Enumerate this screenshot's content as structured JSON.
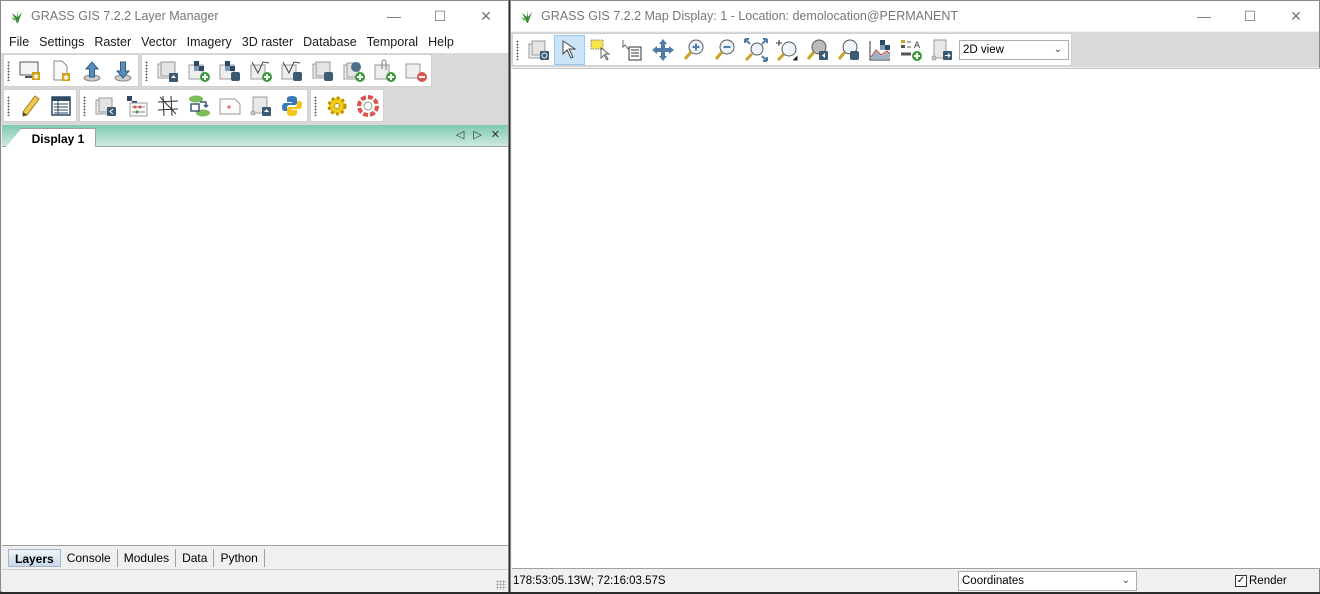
{
  "layer_manager": {
    "title": "GRASS GIS 7.2.2 Layer Manager",
    "window_controls": {
      "minimize": "—",
      "maximize": "☐",
      "close": "✕"
    },
    "menu": [
      "File",
      "Settings",
      "Raster",
      "Vector",
      "Imagery",
      "3D raster",
      "Database",
      "Temporal",
      "Help"
    ],
    "toolbar_row1": {
      "group1": [
        "new-display",
        "new-workspace",
        "load-workspace",
        "save-workspace"
      ],
      "group2": [
        "import-raster",
        "add-raster",
        "add-raster-misc",
        "add-vector",
        "add-vector-misc",
        "add-overlay",
        "add-web-service",
        "add-group",
        "remove-layer"
      ]
    },
    "toolbar_row2": {
      "group1": [
        "edit-vector",
        "attribute-table"
      ],
      "group2": [
        "georectify",
        "raster-calculator",
        "cartographic-composer",
        "graphical-modeler",
        "psmap",
        "script-launcher",
        "python-shell"
      ],
      "group3": [
        "settings",
        "help"
      ]
    },
    "notebook": {
      "tab": "Display 1",
      "controls": {
        "prev": "◁",
        "next": "▷",
        "close": "✕"
      }
    },
    "bottom_tabs": [
      {
        "label": "Layers",
        "selected": true
      },
      {
        "label": "Console",
        "selected": false
      },
      {
        "label": "Modules",
        "selected": false
      },
      {
        "label": "Data",
        "selected": false
      },
      {
        "label": "Python",
        "selected": false
      }
    ]
  },
  "map_display": {
    "title": "GRASS GIS 7.2.2 Map Display: 1 - Location: demolocation@PERMANENT",
    "window_controls": {
      "minimize": "—",
      "maximize": "☐",
      "close": "✕"
    },
    "toolbar": [
      "add-map-elements",
      "pointer",
      "select",
      "query",
      "pan",
      "zoom-in",
      "zoom-out",
      "zoom-extent",
      "zoom-region",
      "zoom-back",
      "zoom-menu",
      "analyze",
      "map-elements",
      "save-export"
    ],
    "active_tool": "pointer",
    "view_mode": {
      "selected": "2D view",
      "arrow": "⌄"
    },
    "status": {
      "coordinates": "178:53:05.13W; 72:16:03.57S",
      "mode": {
        "selected": "Coordinates",
        "arrow": "⌄"
      },
      "render_label": "Render",
      "render_checked": true,
      "check_glyph": "✓"
    }
  },
  "colors": {
    "notebook_gradient_top": "#7fc9b2",
    "notebook_gradient_bottom": "#cdeae0",
    "active_tool_bg": "#cce4f7",
    "window_bg": "#f0f0f0"
  }
}
